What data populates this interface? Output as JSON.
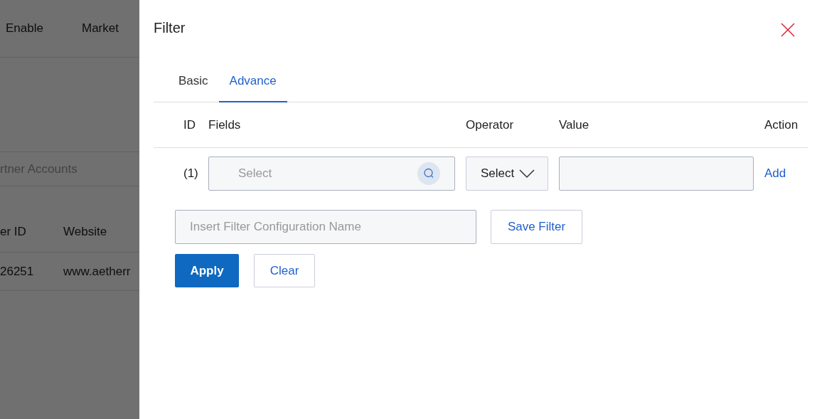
{
  "background_page": {
    "header_columns": [
      "Enable",
      "Market"
    ],
    "search_field": {
      "placeholder": "rtner Accounts"
    },
    "table": {
      "columns": [
        "er ID",
        "Website"
      ],
      "rows": [
        [
          "26251",
          "www.aetherr"
        ]
      ]
    }
  },
  "drawer": {
    "title": "Filter",
    "tabs": [
      {
        "label": "Basic",
        "selected": false
      },
      {
        "label": "Advance",
        "selected": true
      }
    ],
    "columns": [
      "ID",
      "Fields",
      "Operator",
      "Value",
      "Action"
    ],
    "rows": [
      {
        "id": "(1)",
        "field": {
          "placeholder": "Select"
        },
        "operator": "Select",
        "action": "Add"
      }
    ],
    "config_name": {
      "placeholder": "Insert Filter Configuration Name"
    },
    "save_button": "Save Filter",
    "buttons": [
      {
        "label": "Apply",
        "kind": "primary"
      },
      {
        "label": "Clear",
        "kind": "secondary"
      }
    ]
  }
}
